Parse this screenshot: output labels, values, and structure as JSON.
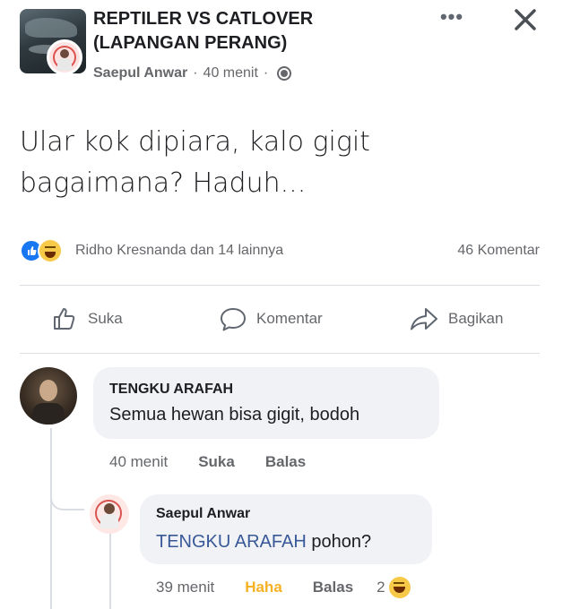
{
  "post": {
    "group_name": "REPTILER VS CATLOVER (LAPANGAN PERANG)",
    "author": "Saepul Anwar",
    "time": "40 menit",
    "separator": "·",
    "text": "Ular kok dipiara, kalo gigit bagaimana? Haduh...",
    "reactions_text": "Ridho Kresnanda dan 14 lainnya",
    "comment_count": "46 Komentar"
  },
  "actions": {
    "like": "Suka",
    "comment": "Komentar",
    "share": "Bagikan"
  },
  "comments": [
    {
      "name": "TENGKU ARAFAH",
      "text": "Semua hewan bisa gigit, bodoh",
      "time": "40 menit",
      "like": "Suka",
      "reply": "Balas"
    },
    {
      "name": "Saepul Anwar",
      "mention": "TENGKU ARAFAH",
      "text": "pohon?",
      "time": "39 menit",
      "reaction": "Haha",
      "reply": "Balas",
      "reaction_count": "2"
    }
  ],
  "icons": {
    "more": "more-icon",
    "close": "close-icon",
    "privacy": "globe-icon",
    "like_reaction": "like-icon",
    "haha_reaction": "haha-icon"
  },
  "colors": {
    "link": "#385898",
    "haha": "#f7b125",
    "like": "#1877f2",
    "muted": "#65676b"
  }
}
